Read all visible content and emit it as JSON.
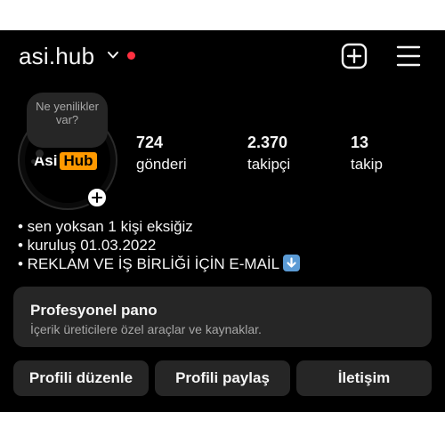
{
  "header": {
    "username": "asi.hub",
    "live_dot_color": "#ff3040",
    "icons": [
      "chevron-down-icon",
      "plus-square-icon",
      "hamburger-menu-icon"
    ]
  },
  "profile": {
    "note_text": "Ne yenilikler var?",
    "avatar_logo": {
      "part1": "Asi",
      "part2": "Hub",
      "accent": "#ff9900"
    }
  },
  "stats": [
    {
      "value": "724",
      "label": "gönderi"
    },
    {
      "value": "2.370",
      "label": "takipçi"
    },
    {
      "value": "13",
      "label": "takip"
    }
  ],
  "bio": {
    "lines": [
      "• sen yoksan 1 kişi eksiğiz",
      "• kuruluş 01.03.2022",
      "• REKLAM VE İŞ BİRLİĞİ İÇİN E-MAİL"
    ],
    "trailing_icon": "down-arrow-emoji-icon"
  },
  "dashboard": {
    "title": "Profesyonel pano",
    "subtitle": "İçerik üreticilere özel araçlar ve kaynaklar."
  },
  "actions": {
    "edit": "Profili düzenle",
    "share": "Profili paylaş",
    "contact": "İletişim"
  }
}
